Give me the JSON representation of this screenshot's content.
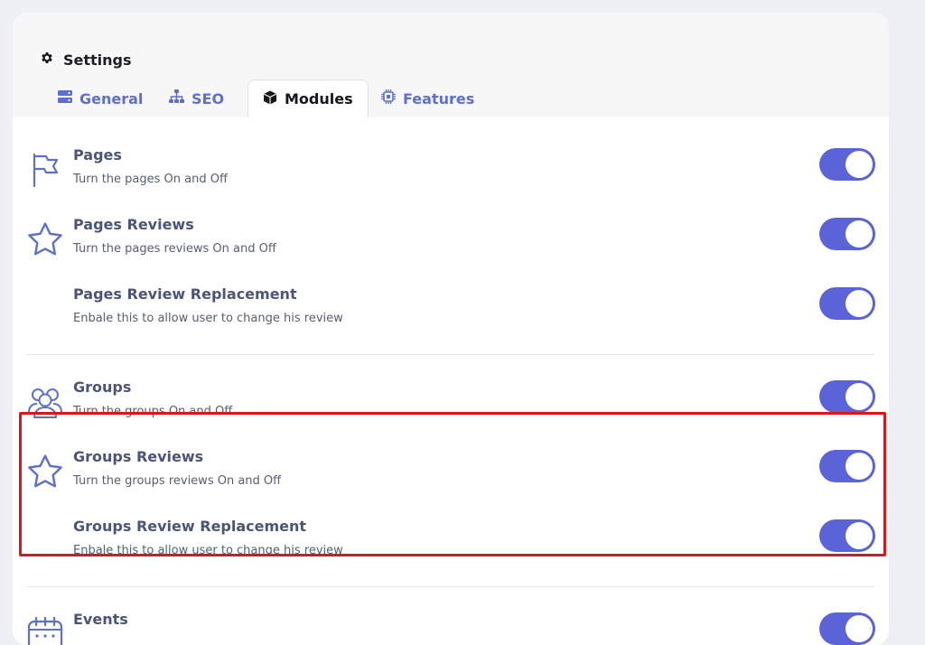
{
  "header": {
    "icon": "gear-icon",
    "title": "Settings"
  },
  "tabs": [
    {
      "label": "General",
      "icon": "server-icon",
      "active": false
    },
    {
      "label": "SEO",
      "icon": "sitemap-icon",
      "active": false
    },
    {
      "label": "Modules",
      "icon": "cube-icon",
      "active": true
    },
    {
      "label": "Features",
      "icon": "chip-icon",
      "active": false
    }
  ],
  "modules": [
    {
      "icon": "flag-icon",
      "title": "Pages",
      "description": "Turn the pages On and Off",
      "enabled": true
    },
    {
      "icon": "star-icon",
      "title": "Pages Reviews",
      "description": "Turn the pages reviews On and Off",
      "enabled": true
    },
    {
      "icon": "",
      "title": "Pages Review Replacement",
      "description": "Enbale this to allow user to change his review",
      "enabled": true
    },
    {
      "icon": "users-icon",
      "title": "Groups",
      "description": "Turn the groups On and Off",
      "enabled": true
    },
    {
      "icon": "star-icon",
      "title": "Groups Reviews",
      "description": "Turn the groups reviews On and Off",
      "enabled": true
    },
    {
      "icon": "",
      "title": "Groups Review Replacement",
      "description": "Enbale this to allow user to change his review",
      "enabled": true
    },
    {
      "icon": "calendar-icon",
      "title": "Events",
      "description": "",
      "enabled": true
    }
  ],
  "colors": {
    "accent": "#5b63d8",
    "highlight": "#e01519"
  }
}
